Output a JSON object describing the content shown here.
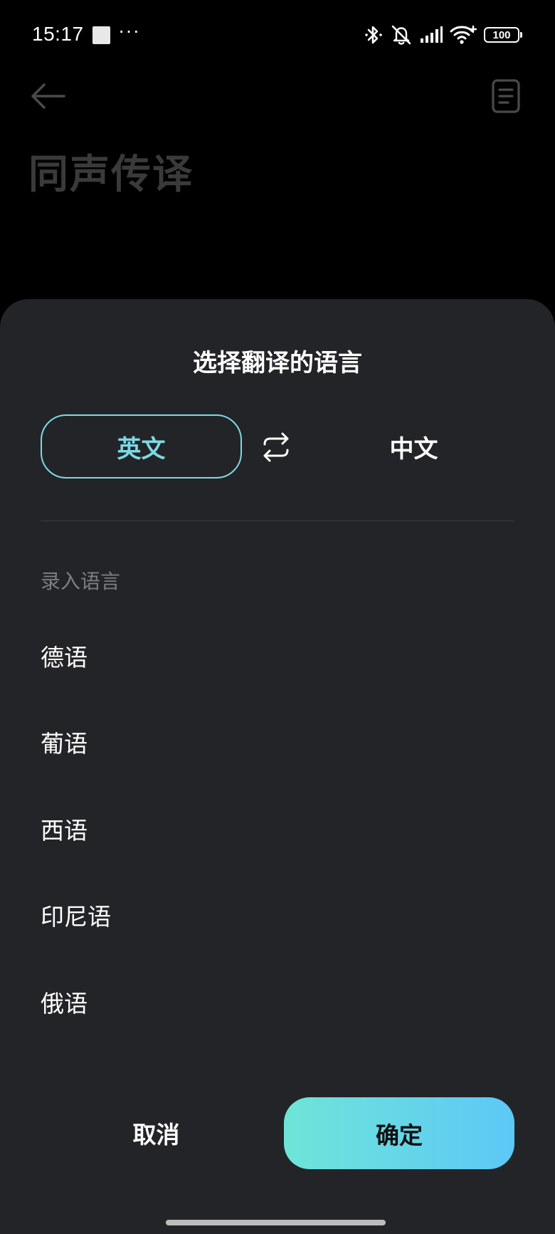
{
  "status_bar": {
    "time": "15:17",
    "dots": "···",
    "battery": "100"
  },
  "app": {
    "title": "同声传译"
  },
  "sheet": {
    "title": "选择翻译的语言",
    "source_language": "英文",
    "target_language": "中文",
    "section_label": "录入语言",
    "languages": [
      "德语",
      "葡语",
      "西语",
      "印尼语",
      "俄语"
    ],
    "cancel_label": "取消",
    "confirm_label": "确定"
  },
  "colors": {
    "sheet_background": "#232427",
    "accent_cyan": "#7cd9e6",
    "confirm_gradient_start": "#6ee5d8",
    "confirm_gradient_end": "#5cc8f7"
  }
}
